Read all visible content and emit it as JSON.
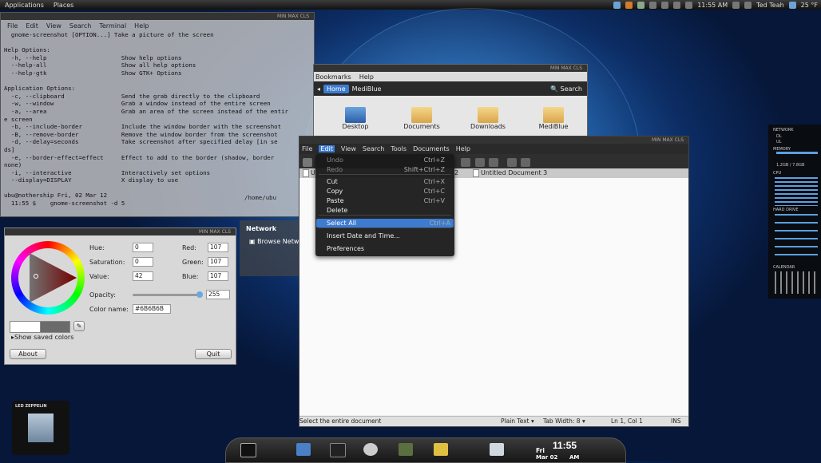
{
  "top_panel": {
    "menus": [
      "Applications",
      "Places"
    ],
    "time": "11:55 AM",
    "user": "Ted Teah",
    "temp": "25 °F"
  },
  "terminal": {
    "title_buttons": "MIN MAX CLS",
    "menu": [
      "File",
      "Edit",
      "View",
      "Search",
      "Terminal",
      "Help"
    ],
    "lines": [
      "  gnome-screenshot [OPTION...] Take a picture of the screen",
      "",
      "Help Options:",
      "  -h, --help                     Show help options",
      "  --help-all                     Show all help options",
      "  --help-gtk                     Show GTK+ Options",
      "",
      "Application Options:",
      "  -c, --clipboard                Send the grab directly to the clipboard",
      "  -w, --window                   Grab a window instead of the entire screen",
      "  -a, --area                     Grab an area of the screen instead of the entir",
      "e screen",
      "  -b, --include-border           Include the window border with the screenshot",
      "  -B, --remove-border            Remove the window border from the screenshot",
      "  -d, --delay=seconds            Take screenshot after specified delay [in se",
      "ds]",
      "  -e, --border-effect=effect     Effect to add to the border (shadow, border",
      "none)",
      "  -i, --interactive              Interactively set options",
      "  --display=DISPLAY              X display to use",
      "",
      "ubu@nothership Fri, 02 Mar 12",
      "  11:55 $    gnome-screenshot -d 5"
    ],
    "path": "/home/ubu"
  },
  "color_picker": {
    "title_buttons": "MIN MAX CLS",
    "hue_label": "Hue:",
    "hue": "0",
    "saturation_label": "Saturation:",
    "saturation": "0",
    "value_label": "Value:",
    "value": "42",
    "red_label": "Red:",
    "red": "107",
    "green_label": "Green:",
    "green": "107",
    "blue_label": "Blue:",
    "blue": "107",
    "opacity_label": "Opacity:",
    "opacity": "255",
    "color_name_label": "Color name:",
    "color_name": "#6B6B6B",
    "show_saved": "Show saved colors",
    "about": "About",
    "quit": "Quit",
    "current_color": "#6b6b6b"
  },
  "nautilus": {
    "title_buttons": "MIN MAX CLS",
    "menu": [
      "Bookmarks",
      "Help"
    ],
    "home": "Home",
    "crumb": "MediBlue",
    "search": "Search",
    "items": [
      "Desktop",
      "Documents",
      "Downloads",
      "MediBlue"
    ]
  },
  "places": {
    "network": "Network",
    "browse": "Browse Netw"
  },
  "gedit": {
    "title_buttons": "MIN MAX CLS",
    "menu": [
      "File",
      "Edit",
      "View",
      "Search",
      "Tools",
      "Documents",
      "Help"
    ],
    "tab_left": "U",
    "tab_mid": "2",
    "tab": "Untitled Document 3",
    "status": "Select the entire document",
    "language": "Plain Text",
    "tab_width": "Tab Width:  8",
    "position": "Ln 1, Col 1",
    "mode": "INS"
  },
  "edit_menu": {
    "items": [
      {
        "label": "Undo",
        "accel": "Ctrl+Z"
      },
      {
        "label": "Redo",
        "accel": "Shift+Ctrl+Z"
      },
      {
        "label": "Cut",
        "accel": "Ctrl+X"
      },
      {
        "label": "Copy",
        "accel": "Ctrl+C"
      },
      {
        "label": "Paste",
        "accel": "Ctrl+V"
      },
      {
        "label": "Delete",
        "accel": ""
      },
      {
        "label": "Select All",
        "accel": "Ctrl+A"
      },
      {
        "label": "Insert Date and Time...",
        "accel": ""
      },
      {
        "label": "Preferences",
        "accel": ""
      }
    ]
  },
  "sysmon": {
    "network": "NETWORK",
    "memory": "MEMORY",
    "mem_value": "1.2GB / 7.8GB",
    "cpu": "CPU",
    "hard_drive": "HARD DRIVE",
    "calendar": "CALENDAR",
    "dl": "DL",
    "ul": "UL"
  },
  "clock": {
    "time": "11:55",
    "day": "Fri",
    "date": "Mar 02",
    "ampm": "AM"
  },
  "album": {
    "title": "LED ZEPPELIN"
  }
}
